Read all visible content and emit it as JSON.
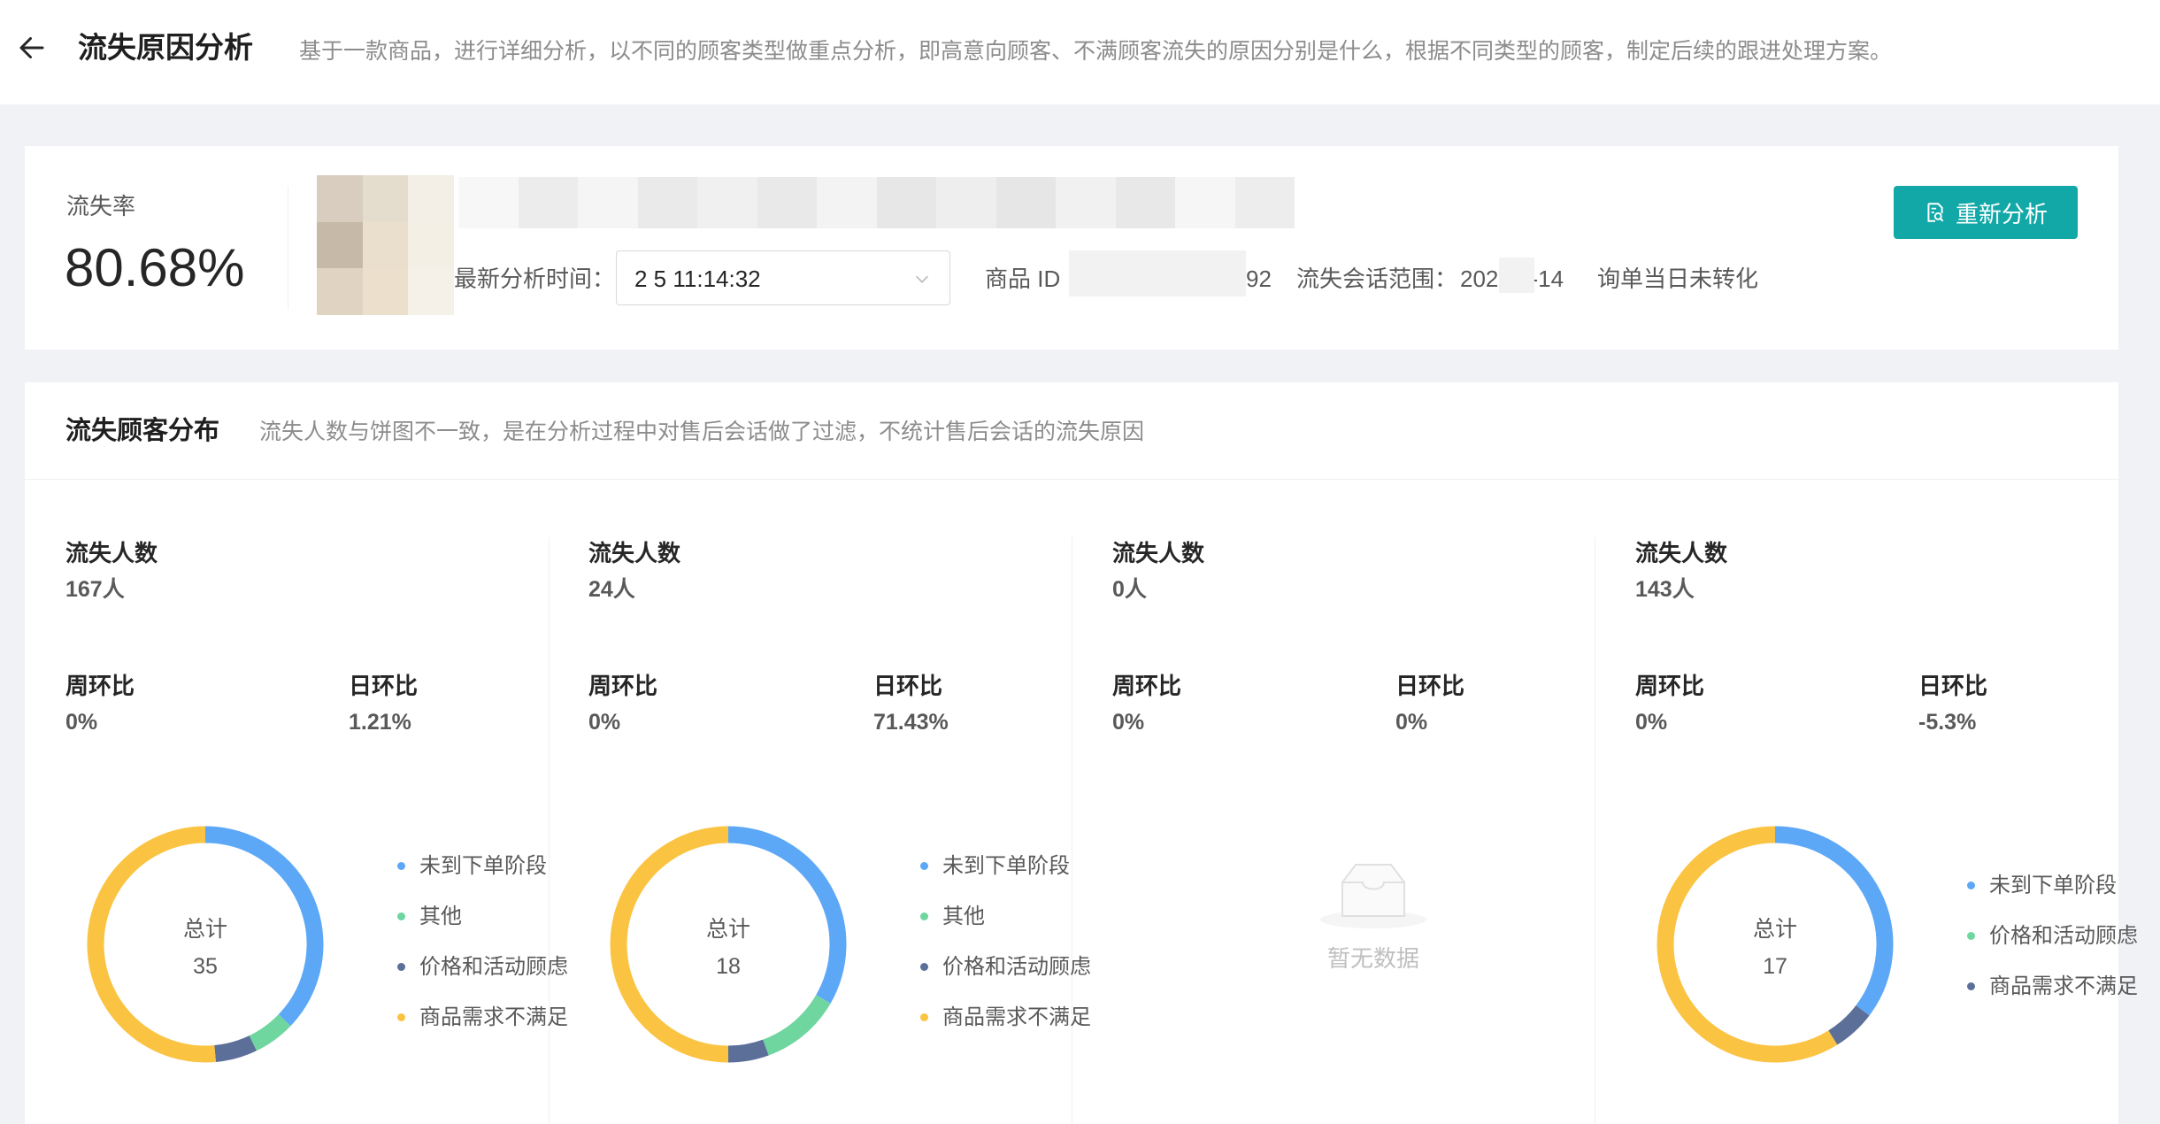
{
  "header": {
    "title": "流失原因分析",
    "description": "基于一款商品，进行详细分析，以不同的顾客类型做重点分析，即高意向顾客、不满顾客流失的原因分别是什么，根据不同类型的顾客，制定后续的跟进处理方案。"
  },
  "summary": {
    "rate_label": "流失率",
    "rate_value": "80.68%",
    "latest_time_label": "最新分析时间：",
    "latest_time_value": "2          5 11:14:32",
    "product_id_label": "商品 ID",
    "product_id_value": "92",
    "session_range_label": "流失会话范围：",
    "session_range_value": "202       01-14",
    "session_rule": "询单当日未转化",
    "reanalyze_label": "重新分析"
  },
  "distribution": {
    "title": "流失顾客分布",
    "note": "流失人数与饼图不一致，是在分析过程中对售后会话做了过滤，不统计售后会话的流失原因",
    "empty_text": "暂无数据",
    "columns": [
      {
        "count_label": "流失人数",
        "count_value": "167人",
        "wow_label": "周环比",
        "wow_value": "0%",
        "dod_label": "日环比",
        "dod_value": "1.21%",
        "donut_total_label": "总计",
        "donut_total_value": "35",
        "legend": [
          "未到下单阶段",
          "其他",
          "价格和活动顾虑",
          "商品需求不满足"
        ]
      },
      {
        "count_label": "流失人数",
        "count_value": "24人",
        "wow_label": "周环比",
        "wow_value": "0%",
        "dod_label": "日环比",
        "dod_value": "71.43%",
        "donut_total_label": "总计",
        "donut_total_value": "18",
        "legend": [
          "未到下单阶段",
          "其他",
          "价格和活动顾虑",
          "商品需求不满足"
        ]
      },
      {
        "count_label": "流失人数",
        "count_value": "0人",
        "wow_label": "周环比",
        "wow_value": "0%",
        "dod_label": "日环比",
        "dod_value": "0%"
      },
      {
        "count_label": "流失人数",
        "count_value": "143人",
        "wow_label": "周环比",
        "wow_value": "0%",
        "dod_label": "日环比",
        "dod_value": "-5.3%",
        "donut_total_label": "总计",
        "donut_total_value": "17",
        "legend": [
          "未到下单阶段",
          "价格和活动顾虑",
          "商品需求不满足"
        ]
      }
    ]
  },
  "colors": {
    "primary_button": "#13a8a8",
    "segment_not_order_stage": "#5ca8f7",
    "segment_other": "#6fd6a0",
    "segment_price_concern": "#5b6f99",
    "segment_demand_unmet": "#fbc342"
  },
  "chart_data": [
    {
      "type": "pie",
      "labels": [
        "未到下单阶段",
        "其他",
        "价格和活动顾虑",
        "商品需求不满足"
      ],
      "values": [
        13,
        2,
        2,
        18
      ],
      "center_label": "总计",
      "center_value": 35
    },
    {
      "type": "pie",
      "labels": [
        "未到下单阶段",
        "其他",
        "价格和活动顾虑",
        "商品需求不满足"
      ],
      "values": [
        6,
        2,
        1,
        9
      ],
      "center_label": "总计",
      "center_value": 18
    },
    {
      "type": "pie",
      "labels": [
        "未到下单阶段",
        "价格和活动顾虑",
        "商品需求不满足"
      ],
      "values": [
        6,
        1,
        10
      ],
      "center_label": "总计",
      "center_value": 17
    }
  ]
}
